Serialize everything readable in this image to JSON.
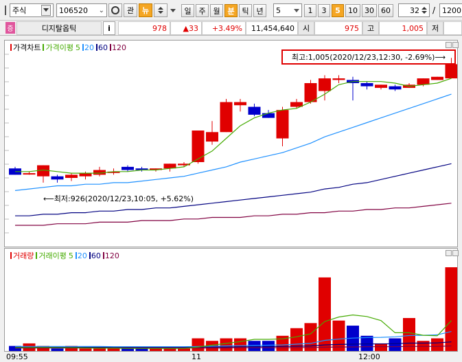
{
  "toolbar": {
    "market_select": "주식",
    "code_input": "106520",
    "btn_gwan": "관",
    "btn_news": "뉴",
    "periods": [
      "일",
      "주",
      "월",
      "분",
      "틱",
      "년"
    ],
    "selected_period": "분",
    "interval_value": "5",
    "interval_buttons": [
      "1",
      "3",
      "5",
      "10",
      "30",
      "60"
    ],
    "selected_interval": "5",
    "count_value": "32",
    "slash": "/",
    "total_value": "1200"
  },
  "quote": {
    "badge": "증",
    "name": "디지탈옵틱",
    "info_btn": "i",
    "price": "978",
    "change": "▲33",
    "change_pct": "+3.49%",
    "volume": "11,454,640",
    "open_label": "시",
    "open_value": "975",
    "high_label": "고",
    "high_value": "1,005",
    "low_label": "저"
  },
  "price_chart": {
    "legend": {
      "title": "가격차트",
      "ma_label": "가격이평",
      "ma": [
        "5",
        "20",
        "60",
        "120"
      ]
    },
    "high_annotation": "최고:1,005(2020/12/23,12:30, -2.69%)⟶",
    "low_annotation": "⟵최저:926(2020/12/23,10:05, +5.62%)"
  },
  "volume_chart": {
    "legend": {
      "title": "거래량",
      "ma_label": "거래이평",
      "ma": [
        "5",
        "20",
        "60",
        "120"
      ]
    }
  },
  "x_labels": [
    "09:55",
    "11",
    "12:00"
  ],
  "colors": {
    "up": "#e00000",
    "down": "#0000cc",
    "ma5": "#44aa00",
    "ma20": "#1e90ff",
    "ma60": "#000080",
    "ma120": "#800040",
    "accent": "#f5a623",
    "annotation_border": "#e00000"
  },
  "chart_data": {
    "type": "candlestick",
    "interval": "5min",
    "candles": [
      {
        "o": 951,
        "h": 952,
        "l": 947,
        "c": 947
      },
      {
        "o": 948,
        "h": 949,
        "l": 947,
        "c": 948
      },
      {
        "o": 946,
        "h": 953,
        "l": 942,
        "c": 953
      },
      {
        "o": 946,
        "h": 947,
        "l": 942,
        "c": 944
      },
      {
        "o": 945,
        "h": 948,
        "l": 943,
        "c": 947
      },
      {
        "o": 946,
        "h": 949,
        "l": 944,
        "c": 948
      },
      {
        "o": 947,
        "h": 952,
        "l": 946,
        "c": 950
      },
      {
        "o": 949,
        "h": 951,
        "l": 947,
        "c": 949
      },
      {
        "o": 952,
        "h": 953,
        "l": 949,
        "c": 950
      },
      {
        "o": 951,
        "h": 952,
        "l": 949,
        "c": 950
      },
      {
        "o": 950,
        "h": 951,
        "l": 949,
        "c": 951
      },
      {
        "o": 951,
        "h": 954,
        "l": 949,
        "c": 954
      },
      {
        "o": 953,
        "h": 955,
        "l": 952,
        "c": 954
      },
      {
        "o": 955,
        "h": 975,
        "l": 954,
        "c": 975
      },
      {
        "o": 968,
        "h": 981,
        "l": 966,
        "c": 974
      },
      {
        "o": 974,
        "h": 995,
        "l": 974,
        "c": 993
      },
      {
        "o": 991,
        "h": 995,
        "l": 987,
        "c": 993
      },
      {
        "o": 990,
        "h": 992,
        "l": 984,
        "c": 985
      },
      {
        "o": 986,
        "h": 988,
        "l": 983,
        "c": 983
      },
      {
        "o": 970,
        "h": 990,
        "l": 965,
        "c": 988
      },
      {
        "o": 990,
        "h": 995,
        "l": 989,
        "c": 993
      },
      {
        "o": 993,
        "h": 1007,
        "l": 992,
        "c": 1005
      },
      {
        "o": 1000,
        "h": 1010,
        "l": 994,
        "c": 1008
      },
      {
        "o": 1007,
        "h": 1010,
        "l": 1005,
        "c": 1008
      },
      {
        "o": 1007,
        "h": 1009,
        "l": 994,
        "c": 1005
      },
      {
        "o": 1005,
        "h": 1006,
        "l": 1001,
        "c": 1003
      },
      {
        "o": 1002,
        "h": 1004,
        "l": 1001,
        "c": 1004
      },
      {
        "o": 1003,
        "h": 1004,
        "l": 1000,
        "c": 1001
      },
      {
        "o": 1002,
        "h": 1005,
        "l": 1002,
        "c": 1004
      },
      {
        "o": 1004,
        "h": 1008,
        "l": 1003,
        "c": 1008
      },
      {
        "o": 1007,
        "h": 1009,
        "l": 1007,
        "c": 1009
      },
      {
        "o": 1008,
        "h": 1021,
        "l": 1008,
        "c": 1017
      }
    ],
    "volume": [
      2,
      3,
      2,
      1,
      2,
      1,
      1,
      1,
      1,
      1,
      1,
      1,
      1,
      5,
      4,
      5,
      5,
      4,
      4,
      6,
      9,
      11,
      29,
      12,
      10,
      6,
      3,
      5,
      13,
      4,
      5,
      33
    ],
    "ma5": [
      949,
      949,
      950,
      949,
      948,
      948,
      948,
      949,
      949,
      950,
      950,
      951,
      952,
      957,
      962,
      970,
      978,
      983,
      986,
      988,
      989,
      993,
      998,
      1004,
      1006,
      1006,
      1006,
      1005,
      1003,
      1004,
      1005,
      1008
    ],
    "ma20": [
      937,
      938,
      939,
      940,
      940,
      941,
      941,
      942,
      942,
      943,
      944,
      945,
      946,
      948,
      950,
      952,
      955,
      957,
      959,
      961,
      964,
      967,
      971,
      974,
      977,
      980,
      983,
      986,
      989,
      992,
      995,
      998
    ],
    "ma60": [
      921,
      921,
      922,
      922,
      923,
      923,
      924,
      924,
      925,
      925,
      926,
      926,
      927,
      928,
      929,
      930,
      931,
      932,
      933,
      934,
      935,
      936,
      938,
      939,
      941,
      942,
      944,
      946,
      948,
      950,
      952,
      954
    ],
    "ma120": [
      915,
      915,
      915,
      916,
      916,
      916,
      917,
      917,
      917,
      918,
      918,
      918,
      919,
      919,
      920,
      920,
      920,
      921,
      921,
      922,
      922,
      923,
      923,
      924,
      924,
      925,
      925,
      926,
      926,
      927,
      928,
      929
    ],
    "vol_ma5": [
      1.3,
      1.4,
      1.4,
      1.3,
      1.3,
      1.2,
      1.1,
      1.1,
      1.0,
      1.0,
      1.0,
      1.0,
      1.0,
      1.6,
      2.3,
      3.0,
      3.7,
      4.6,
      4.6,
      4.8,
      5.6,
      6.8,
      11.6,
      13.4,
      14.2,
      13.6,
      12.0,
      7.2,
      7.2,
      6.2,
      6.0,
      12.0
    ],
    "vol_ma20": [
      1.8,
      1.8,
      1.8,
      1.8,
      1.8,
      1.8,
      1.8,
      1.7,
      1.7,
      1.7,
      1.7,
      1.7,
      1.7,
      1.8,
      1.9,
      2.0,
      2.1,
      2.2,
      2.3,
      2.4,
      2.7,
      3.0,
      4.2,
      4.7,
      5.1,
      5.3,
      5.4,
      5.6,
      6.1,
      6.2,
      6.4,
      7.7
    ],
    "vol_ma60": [
      1.5,
      1.5,
      1.5,
      1.5,
      1.5,
      1.5,
      1.5,
      1.5,
      1.5,
      1.5,
      1.5,
      1.5,
      1.5,
      1.6,
      1.6,
      1.6,
      1.7,
      1.7,
      1.7,
      1.8,
      1.9,
      2.0,
      2.4,
      2.6,
      2.7,
      2.8,
      2.8,
      2.9,
      3.1,
      3.1,
      3.2,
      3.6
    ],
    "vol_ma120": [
      1.2,
      1.2,
      1.2,
      1.2,
      1.2,
      1.2,
      1.2,
      1.2,
      1.2,
      1.2,
      1.2,
      1.2,
      1.2,
      1.2,
      1.2,
      1.2,
      1.3,
      1.3,
      1.3,
      1.3,
      1.3,
      1.4,
      1.5,
      1.6,
      1.6,
      1.7,
      1.7,
      1.7,
      1.8,
      1.8,
      1.8,
      2.0
    ],
    "price_range": [
      905,
      1025
    ],
    "volume_range": [
      0,
      36
    ]
  }
}
